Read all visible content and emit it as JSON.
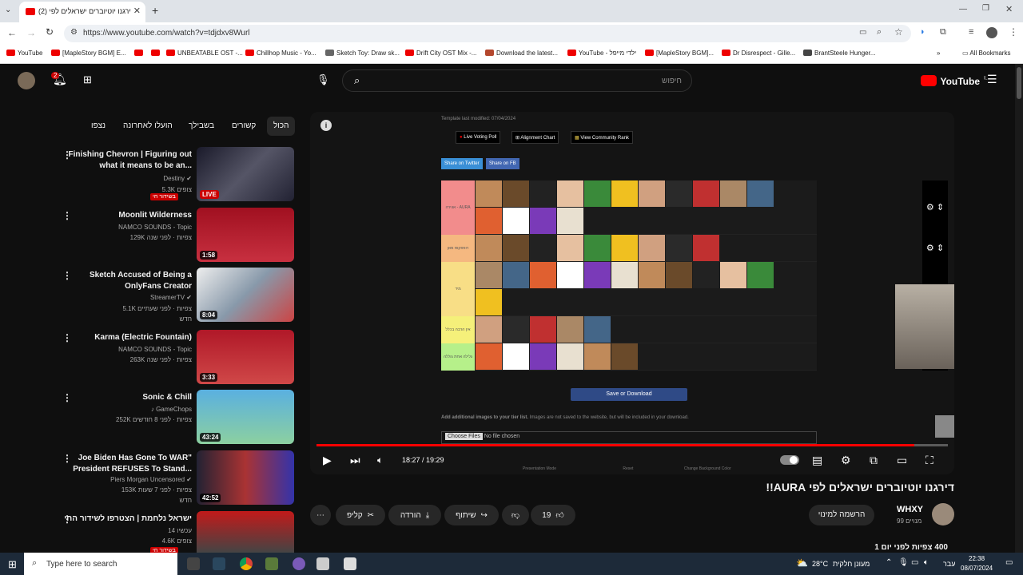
{
  "browser": {
    "tab_title": "(2) דירגנו יוטיוברים ישראלים לפי",
    "new_tab": "+",
    "url": "https://www.youtube.com/watch?v=tdjdxv8Wurl",
    "bookmarks": [
      "YouTube",
      "[MapleStory BGM] E...",
      "UNBEATABLE OST -...",
      "Chillhop Music - Yo...",
      "Sketch Toy: Draw sk...",
      "Drift City OST Mix -...",
      "Download the latest...",
      "YouTube - ילדי מייפל",
      "[MapleStory BGM]...",
      "Dr Disrespect - Gille...",
      "BrantSteele Hunger..."
    ],
    "all_bookmarks": "All Bookmarks"
  },
  "youtube": {
    "search_placeholder": "חיפוש",
    "logo": "YouTube",
    "country": "IL",
    "notif_count": "2",
    "chips": [
      "הכול",
      "קשורים",
      "בשבילך",
      "הועלו לאחרונה",
      "נצפו"
    ],
    "videos": [
      {
        "title_1": "Finishing Chevron | Figuring out",
        "title_2": "what it means to be an...",
        "channel": "Destiny",
        "meta": "5.3K צופים",
        "badge": "בשידור חי",
        "live": "LIVE"
      },
      {
        "title_1": "Moonlit Wilderness",
        "title_2": "",
        "channel": "NAMCO SOUNDS - Topic",
        "meta": "129K צפיות · לפני שנה",
        "duration": "1:58"
      },
      {
        "title_1": "Sketch Accused of Being a",
        "title_2": "OnlyFans Creator",
        "channel": "StreamerTV",
        "meta": "5.1K צפיות · לפני שעתיים",
        "meta2": "חדש",
        "duration": "8:04"
      },
      {
        "title_1": "Karma (Electric Fountain)",
        "title_2": "",
        "channel": "NAMCO SOUNDS - Topic",
        "meta": "263K צפיות · לפני שנה",
        "duration": "3:33"
      },
      {
        "title_1": "Sonic & Chill",
        "title_2": "",
        "channel": "GameChops",
        "meta": "252K צפיות · לפני 8 חודשים",
        "duration": "43:24"
      },
      {
        "title_1": "Joe Biden Has Gone To WAR\"",
        "title_2": "President REFUSES To Stand...",
        "channel": "Piers Morgan Uncensored",
        "meta": "153K צפיות · לפני 7 שעות",
        "meta2": "חדש",
        "duration": "42:52"
      },
      {
        "title_1": "ישראל נלחמת | הצטרפו לשידור החי",
        "title_2": "",
        "channel": "עכשיו 14",
        "meta": "4.6K צופים",
        "badge": "בשידור חי"
      }
    ],
    "player": {
      "template_modified": "Template last modified: 07/04/2024",
      "buttons": [
        "Live Voting Poll",
        "Alignment Chart",
        "View Community Rank"
      ],
      "share_twitter": "Share on Twitter",
      "share_fb": "Share on FB",
      "tiers": [
        "אווירה - AURA",
        "רופפקוס מאן",
        "מיד",
        "אין הרבה בכלל",
        "גלילה אחת גוללה"
      ],
      "save_button": "Save or Download",
      "add_images": "Add additional images to your tier list.",
      "add_images_note": "Images are not saved to the website, but will be included in your download.",
      "choose_files": "Choose Files",
      "no_file": "No file chosen",
      "footer_links": [
        "Presentation Mode",
        "Reset",
        "Change Background Color"
      ],
      "time": "18:27 / 19:29",
      "progress": 0.947
    },
    "video_title": "דירגנו יוטיוברים ישראלים לפי AURA!!",
    "channel_name": "WHXY",
    "subscribers": "99 מנויים",
    "subscribe": "הרשמה למינוי",
    "likes": "19",
    "share": "שיתוף",
    "download": "הורדה",
    "clip": "קליפ",
    "views": "400 צפיות  לפני יום 1"
  },
  "taskbar": {
    "search": "Type here to search",
    "weather": "28°C",
    "weather_text": "מעונן חלקית",
    "lang": "עבר",
    "time": "22:38",
    "date": "08/07/2024"
  }
}
